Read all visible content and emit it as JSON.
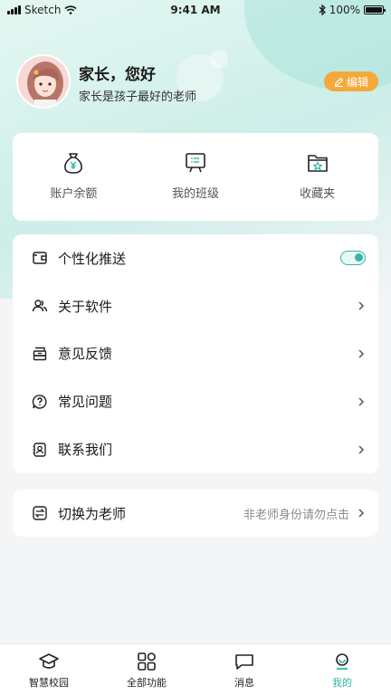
{
  "status_bar": {
    "carrier": "Sketch",
    "time": "9:41 AM",
    "battery": "100%"
  },
  "profile": {
    "greeting": "家长，您好",
    "subtitle": "家长是孩子最好的老师",
    "edit_label": "编辑"
  },
  "quick_actions": [
    {
      "label": "账户余额",
      "icon": "money-bag-icon"
    },
    {
      "label": "我的班级",
      "icon": "presentation-board-icon"
    },
    {
      "label": "收藏夹",
      "icon": "star-folder-icon"
    }
  ],
  "menu": {
    "push": {
      "label": "个性化推送",
      "toggle_on": true
    },
    "items": [
      {
        "label": "关于软件",
        "icon": "users-icon"
      },
      {
        "label": "意见反馈",
        "icon": "feedback-icon"
      },
      {
        "label": "常见问题",
        "icon": "question-icon"
      },
      {
        "label": "联系我们",
        "icon": "contact-icon"
      }
    ]
  },
  "switch_role": {
    "label": "切换为老师",
    "hint": "非老师身份请勿点击"
  },
  "tabbar": [
    {
      "label": "智慧校园",
      "icon": "graduation-cap-icon",
      "active": false
    },
    {
      "label": "全部功能",
      "icon": "grid-icon",
      "active": false
    },
    {
      "label": "消息",
      "icon": "message-icon",
      "active": false
    },
    {
      "label": "我的",
      "icon": "profile-icon",
      "active": true
    }
  ],
  "colors": {
    "accent": "#2fb7a6",
    "edit_button": "#f5a93b"
  }
}
